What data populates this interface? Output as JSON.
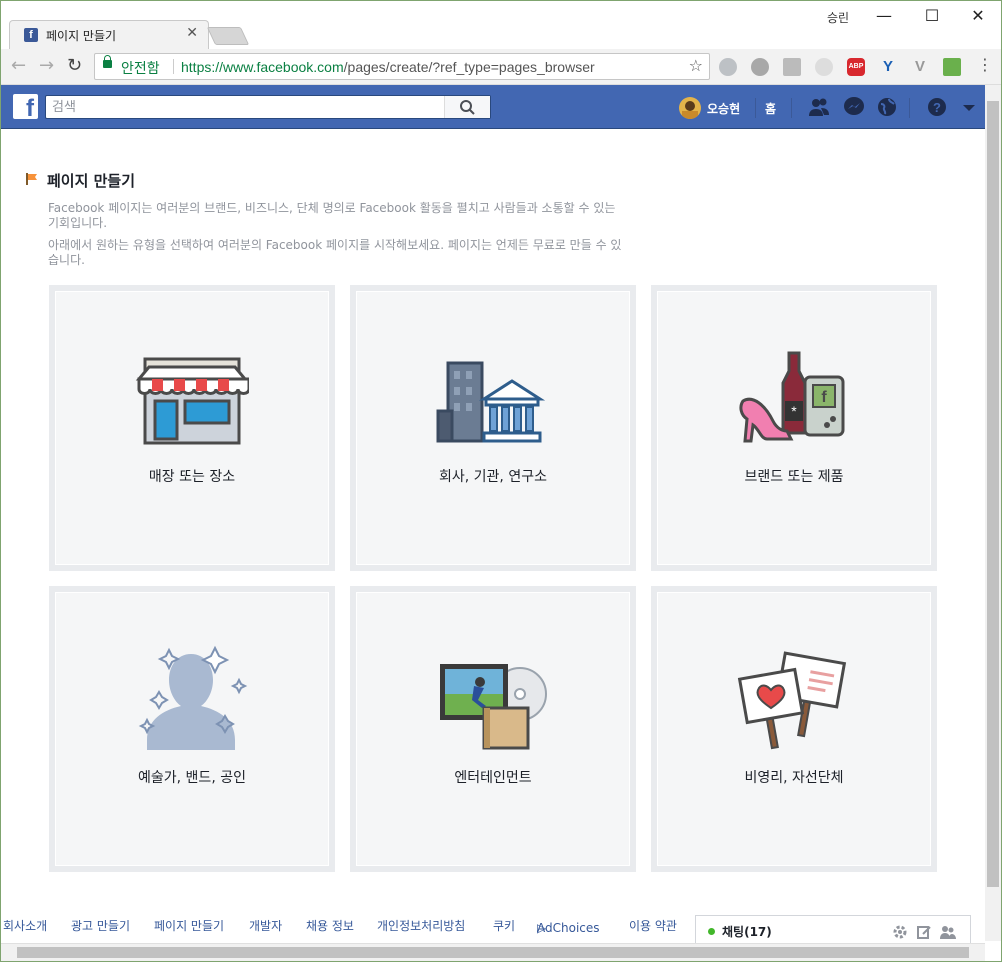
{
  "browser": {
    "tab_title": "페이지 만들기",
    "profile_name": "승린",
    "secure_label": "안전함",
    "url_scheme_host": "https://www.facebook.com",
    "url_path": "/pages/create/?ref_type=pages_browser"
  },
  "fb": {
    "search_placeholder": "검색",
    "user_name": "오승현",
    "home_label": "홈"
  },
  "page": {
    "title": "페이지 만들기",
    "desc1": "Facebook 페이지는 여러분의 브랜드, 비즈니스, 단체 명의로 Facebook 활동을 펼치고 사람들과 소통할 수 있는 기회입니다.",
    "desc2": "아래에서 원하는 유형을 선택하여 여러분의 Facebook 페이지를 시작해보세요. 페이지는 언제든 무료로 만들 수 있습니다.",
    "categories": [
      {
        "label": "매장 또는 장소",
        "icon": "storefront-icon"
      },
      {
        "label": "회사, 기관, 연구소",
        "icon": "building-icon"
      },
      {
        "label": "브랜드 또는 제품",
        "icon": "products-icon"
      },
      {
        "label": "예술가, 밴드, 공인",
        "icon": "person-silhouette-icon"
      },
      {
        "label": "엔터테인먼트",
        "icon": "tv-media-icon"
      },
      {
        "label": "비영리, 자선단체",
        "icon": "picket-signs-icon"
      }
    ]
  },
  "footer": {
    "links": [
      "회사소개",
      "광고 만들기",
      "페이지 만들기",
      "개발자",
      "채용 정보",
      "개인정보처리방침",
      "쿠키",
      "AdChoices",
      "이용 약관"
    ]
  },
  "chat": {
    "label": "채팅(17)"
  },
  "colors": {
    "fb_blue": "#4267b2",
    "link": "#365899",
    "secure_green": "#0b8043"
  }
}
